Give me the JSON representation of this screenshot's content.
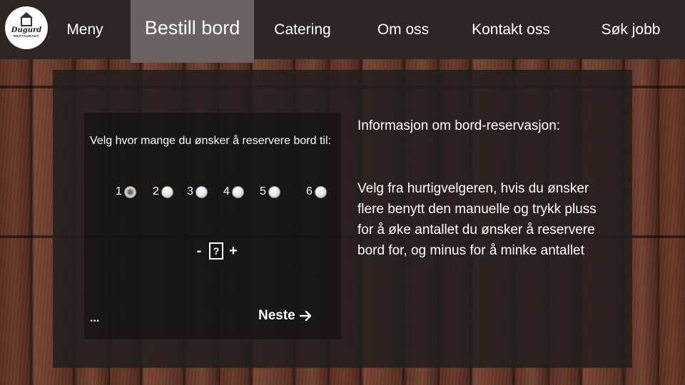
{
  "brand": {
    "name": "Dugurd",
    "tagline": "RESTAURANT",
    "est_left": "EST",
    "est_right": "SINCE"
  },
  "nav": {
    "items": [
      {
        "label": "Meny"
      },
      {
        "label": "Bestill bord",
        "active": true
      },
      {
        "label": "Catering"
      },
      {
        "label": "Om oss"
      },
      {
        "label": "Kontakt oss"
      },
      {
        "label": "Søk jobb"
      }
    ]
  },
  "reservation": {
    "question": "Velg hvor mange du ønsker å reservere bord til:",
    "quick_options": [
      {
        "label": "1",
        "selected": true
      },
      {
        "label": "2",
        "selected": false
      },
      {
        "label": "3",
        "selected": false
      },
      {
        "label": "4",
        "selected": false
      },
      {
        "label": "5",
        "selected": false
      },
      {
        "label": "6",
        "selected": false
      }
    ],
    "stepper": {
      "minus": "-",
      "value": "?",
      "plus": "+"
    },
    "ellipsis": "...",
    "next_label": "Neste"
  },
  "info": {
    "title": "Informasjon om bord-reservasjon:",
    "body": "Velg fra hurtigvelgeren, hvis du ønsker flere benytt den manuelle og trykk pluss for å øke antallet du ønsker å reservere bord for, og minus for å minke antallet"
  },
  "colors": {
    "navbar": "#2e2623",
    "nav_active": "#6a6260",
    "panel": "#231e1c",
    "text": "#ffffff"
  }
}
